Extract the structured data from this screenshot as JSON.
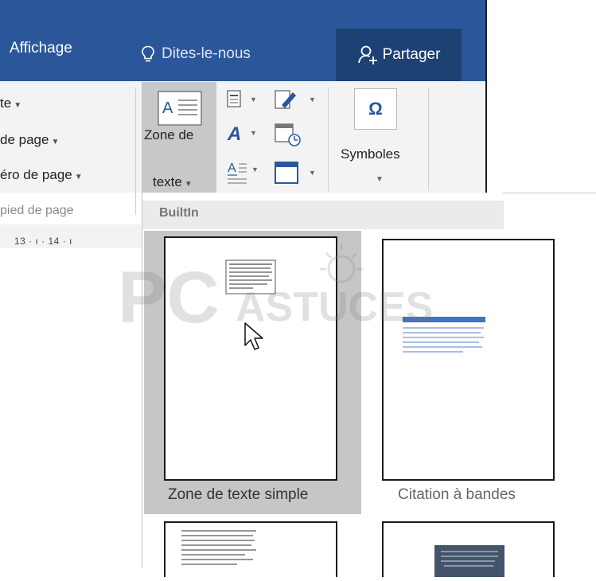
{
  "tabs": {
    "view": "Affichage",
    "tell_me": "Dites-le-nous",
    "share": "Partager"
  },
  "ribbon": {
    "menu_items": [
      "te",
      "de page",
      "éro de page"
    ],
    "group_label": "pied de page",
    "text_box_label_line1": "Zone de",
    "text_box_label_line2": "texte",
    "symbols_label": "Symboles"
  },
  "ruler": {
    "ticks": "13 · ı · 14 · ı"
  },
  "gallery": {
    "header": "BuiltIn",
    "items": [
      {
        "label": "Zone de texte simple"
      },
      {
        "label": "Citation à bandes"
      }
    ]
  },
  "watermark": {
    "text1": "PC",
    "text2": "ASTUCES"
  },
  "colors": {
    "accent": "#2b579a",
    "share_bg": "#1e4174",
    "highlight": "#c6c6c6",
    "ribbon_bg": "#f3f3f3"
  }
}
